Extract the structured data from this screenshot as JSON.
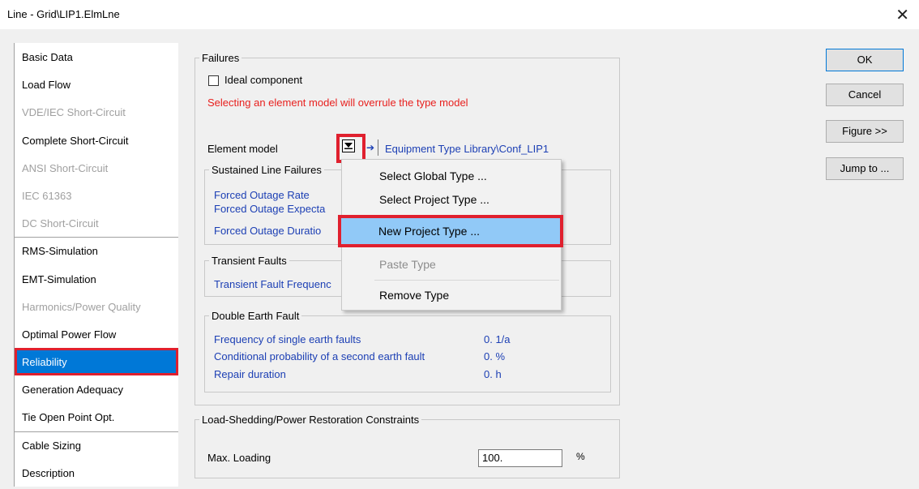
{
  "window": {
    "title": "Line - Grid\\LIP1.ElmLne",
    "close_glyph": "✕"
  },
  "tabs": [
    {
      "label": "Basic Data",
      "state": "normal"
    },
    {
      "label": "Load Flow",
      "state": "normal"
    },
    {
      "label": "VDE/IEC Short-Circuit",
      "state": "disabled"
    },
    {
      "label": "Complete Short-Circuit",
      "state": "normal"
    },
    {
      "label": "ANSI Short-Circuit",
      "state": "disabled"
    },
    {
      "label": "IEC 61363",
      "state": "disabled"
    },
    {
      "label": "DC Short-Circuit",
      "state": "disabled"
    },
    {
      "label": "RMS-Simulation",
      "state": "normal"
    },
    {
      "label": "EMT-Simulation",
      "state": "normal"
    },
    {
      "label": "Harmonics/Power Quality",
      "state": "disabled"
    },
    {
      "label": "Optimal Power Flow",
      "state": "normal"
    },
    {
      "label": "Reliability",
      "state": "selected"
    },
    {
      "label": "Generation Adequacy",
      "state": "normal"
    },
    {
      "label": "Tie Open Point Opt.",
      "state": "normal"
    },
    {
      "label": "Cable Sizing",
      "state": "normal"
    },
    {
      "label": "Description",
      "state": "normal"
    }
  ],
  "failures": {
    "legend": "Failures",
    "ideal_component": {
      "label": "Ideal component",
      "checked": false
    },
    "warning": "Selecting an element model will overrule the type model",
    "element_model_label": "Element model",
    "arrow_glyph": "➔",
    "type_path": "Equipment Type Library\\Conf_LIP1"
  },
  "sustained": {
    "legend": "Sustained Line Failures",
    "items": [
      "Forced Outage Rate",
      "Forced Outage Expecta",
      "Forced Outage Duratio"
    ]
  },
  "transient": {
    "legend": "Transient Faults",
    "items": [
      "Transient Fault Frequenc"
    ]
  },
  "double_earth": {
    "legend": "Double Earth Fault",
    "rows": [
      {
        "label": "Frequency of single earth faults",
        "value": "0. 1/a"
      },
      {
        "label": "Conditional probability of a second earth fault",
        "value": "0. %"
      },
      {
        "label": "Repair duration",
        "value": "0. h"
      }
    ]
  },
  "load_shedding": {
    "legend": "Load-Shedding/Power Restoration Constraints",
    "max_loading_label": "Max. Loading",
    "max_loading_value": "100.",
    "unit": "%"
  },
  "context_menu": {
    "items": [
      {
        "label": "Select Global Type ...",
        "state": "normal"
      },
      {
        "label": "Select Project Type ...",
        "state": "normal"
      },
      {
        "label": "New Project Type ...",
        "state": "highlighted"
      },
      {
        "label": "Paste Type",
        "state": "disabled"
      },
      {
        "label": "Remove Type",
        "state": "normal"
      }
    ]
  },
  "buttons": {
    "ok": "OK",
    "cancel": "Cancel",
    "figure": "Figure >>",
    "jump_to": "Jump to ..."
  },
  "colors": {
    "selection_blue": "#0078d7",
    "highlight_red": "#e0202e",
    "link_blue": "#1c3fb4",
    "warning_red": "#e8201e",
    "menu_highlight": "#91c9f7"
  }
}
